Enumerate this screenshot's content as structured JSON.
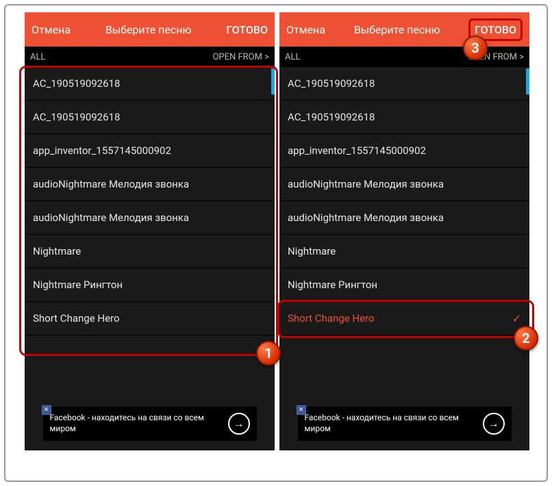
{
  "header": {
    "cancel": "Отмена",
    "title": "Выберите песню",
    "done": "ГОТОВО"
  },
  "subheader": {
    "all": "ALL",
    "open_from": "OPEN FROM >"
  },
  "songs": [
    "AC_190519092618",
    "AC_190519092618",
    "app_inventor_1557145000902",
    "audioNightmare Мелодия звонка",
    "audioNightmare Мелодия звонка",
    "Nightmare",
    "Nightmare Рингтон",
    "Short Change Hero"
  ],
  "selected_index": 7,
  "ad": {
    "text": "Facebook - находитесь на связи со всем миром"
  },
  "badges": {
    "b1": "1",
    "b2": "2",
    "b3": "3"
  }
}
